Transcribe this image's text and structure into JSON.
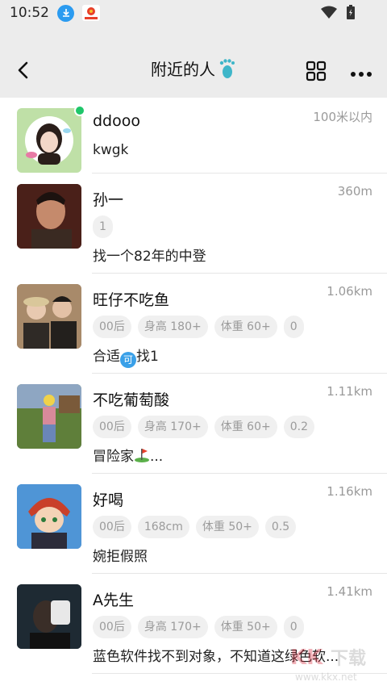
{
  "status": {
    "time": "10:52"
  },
  "header": {
    "title": "附近的人"
  },
  "users": [
    {
      "name": "ddooo",
      "distance": "100米以内",
      "tags": [],
      "bio": "kwgk",
      "online": true,
      "avatar_bg": "#bfe0a7"
    },
    {
      "name": "孙一",
      "distance": "360m",
      "tags": [
        "1"
      ],
      "bio": "找一个82年的中登",
      "online": false,
      "avatar_bg": "#5a2a22"
    },
    {
      "name": "旺仔不吃鱼",
      "distance": "1.06km",
      "tags": [
        "00后",
        "身高 180+",
        "体重 60+",
        "0"
      ],
      "bio_prefix": "合适",
      "bio_suffix": "找1",
      "emoji": "可",
      "online": false,
      "avatar_bg": "#8a6b52"
    },
    {
      "name": "不吃葡萄酸",
      "distance": "1.11km",
      "tags": [
        "00后",
        "身高 170+",
        "体重 60+",
        "0.2"
      ],
      "bio_prefix": "冒险家",
      "bio_suffix": "...",
      "online": false,
      "avatar_bg": "#6f8a4a"
    },
    {
      "name": "好喝",
      "distance": "1.16km",
      "tags": [
        "00后",
        "168cm",
        "体重 50+",
        "0.5"
      ],
      "bio": "婉拒假照",
      "online": false,
      "avatar_bg": "#3c7fc8"
    },
    {
      "name": "A先生",
      "distance": "1.41km",
      "tags": [
        "00后",
        "身高 170+",
        "体重 50+",
        "0"
      ],
      "bio": "蓝色软件找不到对象，不知道这绿色软...",
      "online": false,
      "avatar_bg": "#2c3640"
    }
  ],
  "watermark": "www.kkx.net"
}
